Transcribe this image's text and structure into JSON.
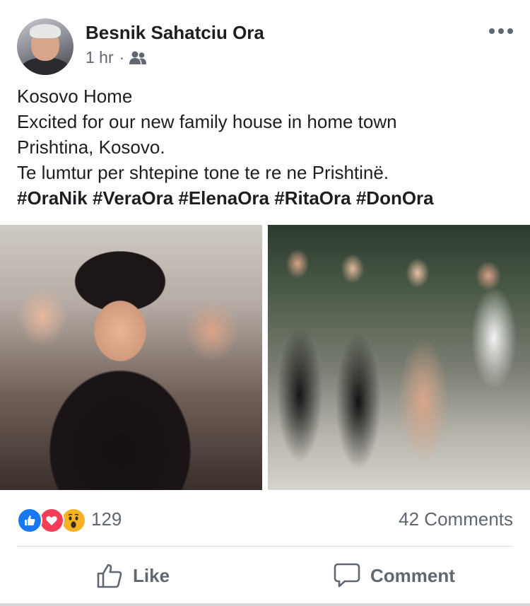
{
  "post": {
    "author": "Besnik Sahatciu Ora",
    "time": "1 hr",
    "separator": "·",
    "audience_icon": "friends-icon",
    "more_icon": "more-options-icon",
    "text_lines": [
      "Kosovo Home",
      "Excited for our new family house in home town",
      "Prishtina, Kosovo.",
      "Te lumtur per shtepine tone te re ne Prishtinë."
    ],
    "hashtags": "#OraNik #VeraOra #ElenaOra #RitaOra #DonOra"
  },
  "reactions": {
    "types": [
      "like",
      "love",
      "wow"
    ],
    "count": "129",
    "comments": "42 Comments"
  },
  "actions": {
    "like_label": "Like",
    "comment_label": "Comment"
  },
  "colors": {
    "like_blue": "#1877f2",
    "love_red": "#f33e58",
    "wow_yellow": "#f7b125",
    "secondary_text": "#606770"
  }
}
